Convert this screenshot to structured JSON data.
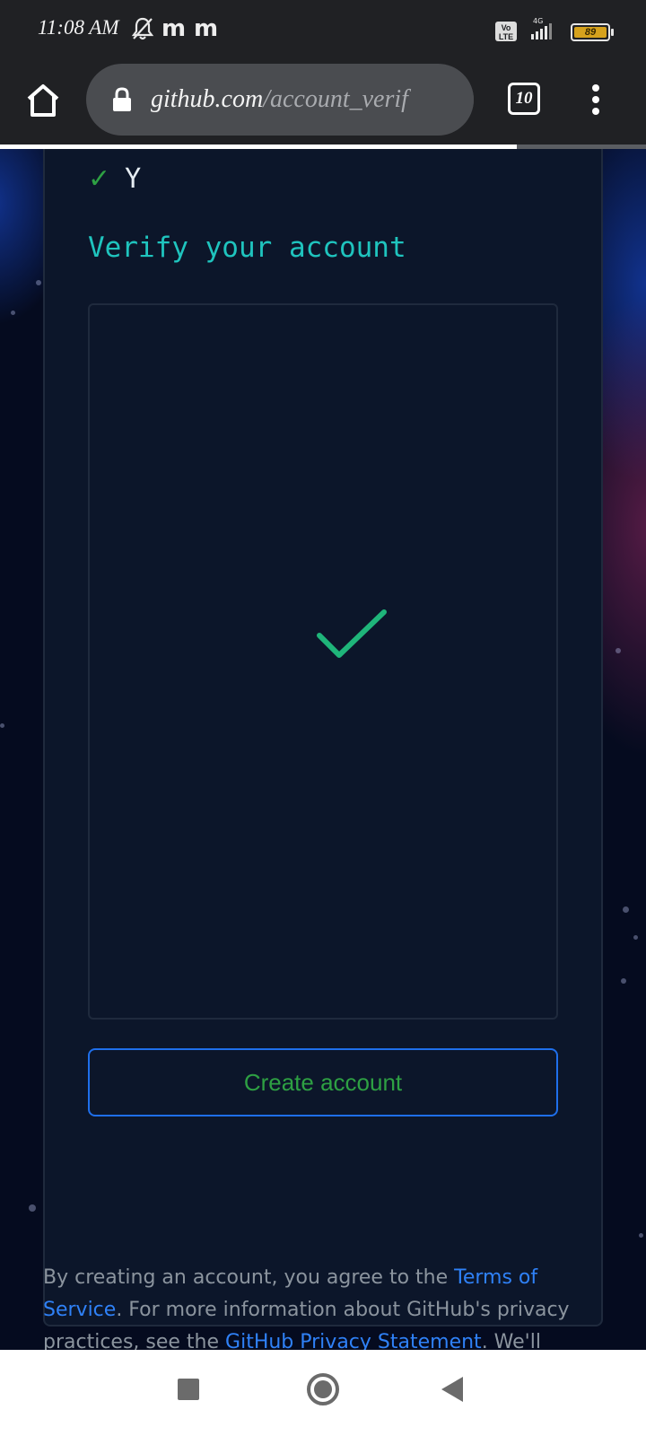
{
  "status_bar": {
    "time": "11:08 AM",
    "notification_icons": [
      "bell-off-icon",
      "m-icon",
      "m-icon"
    ],
    "network": "4G",
    "volte": "Vo LTE",
    "battery_level": "89"
  },
  "browser": {
    "url_host": "github.com",
    "url_path": "/account_verif",
    "tab_count": "10",
    "load_progress": 0.8
  },
  "page": {
    "check_value": "Y",
    "verify_title": "Verify your account",
    "captcha_status": "check-icon",
    "create_button": "Create account",
    "footer": {
      "text_1": "By creating an account, you agree to the ",
      "terms_link": "Terms of Service",
      "text_2": ". For more information about GitHub's privacy practices, see the ",
      "privacy_link": "GitHub Privacy Statement",
      "text_3": ". We'll occasionally send you"
    }
  },
  "colors": {
    "accent_teal": "#1fc4be",
    "success_green": "#2ea043",
    "link_blue": "#2f81f7",
    "card_bg": "#0c162a"
  }
}
